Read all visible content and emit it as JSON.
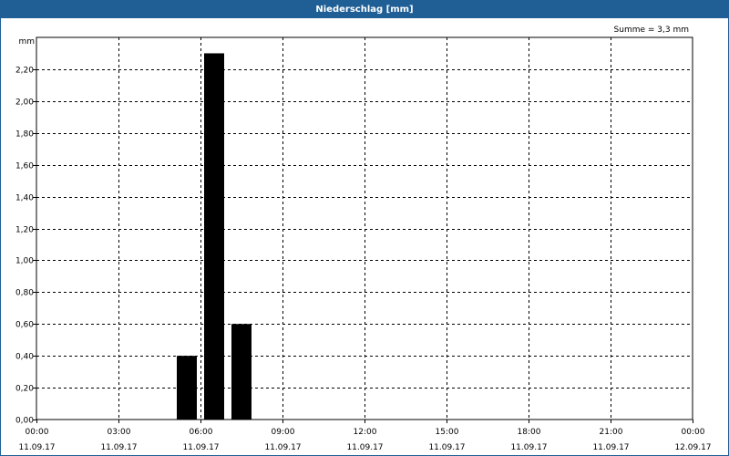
{
  "header": {
    "title": "Niederschlag [mm]"
  },
  "summary": {
    "text": "Summe = 3,3 mm"
  },
  "colors": {
    "titlebar": "#1f5f96",
    "bars": "#000000",
    "grid": "#000000"
  },
  "chart_data": {
    "type": "bar",
    "title": "Niederschlag [mm]",
    "ylabel": "mm",
    "xlabel": "",
    "ylim": [
      0,
      2.4
    ],
    "yticks": [
      0,
      0.2,
      0.4,
      0.6,
      0.8,
      1.0,
      1.2,
      1.4,
      1.6,
      1.8,
      2.0,
      2.2
    ],
    "ytick_labels": [
      "0,00",
      "0,20",
      "0,40",
      "0,60",
      "0,80",
      "1,00",
      "1,20",
      "1,40",
      "1,60",
      "1,80",
      "2,00",
      "2,20"
    ],
    "xlim": [
      0,
      24
    ],
    "xticks": [
      {
        "hour": 0,
        "time": "00:00",
        "date": "11.09.17"
      },
      {
        "hour": 3,
        "time": "03:00",
        "date": "11.09.17"
      },
      {
        "hour": 6,
        "time": "06:00",
        "date": "11.09.17"
      },
      {
        "hour": 9,
        "time": "09:00",
        "date": "11.09.17"
      },
      {
        "hour": 12,
        "time": "12:00",
        "date": "11.09.17"
      },
      {
        "hour": 15,
        "time": "15:00",
        "date": "11.09.17"
      },
      {
        "hour": 18,
        "time": "18:00",
        "date": "11.09.17"
      },
      {
        "hour": 21,
        "time": "21:00",
        "date": "11.09.17"
      },
      {
        "hour": 24,
        "time": "00:00",
        "date": "12.09.17"
      }
    ],
    "bars": [
      {
        "start": 5.0,
        "end": 6.0,
        "value": 0.4
      },
      {
        "start": 6.0,
        "end": 7.0,
        "value": 2.3
      },
      {
        "start": 7.0,
        "end": 8.0,
        "value": 0.6
      }
    ],
    "grid": true,
    "total": 3.3
  }
}
